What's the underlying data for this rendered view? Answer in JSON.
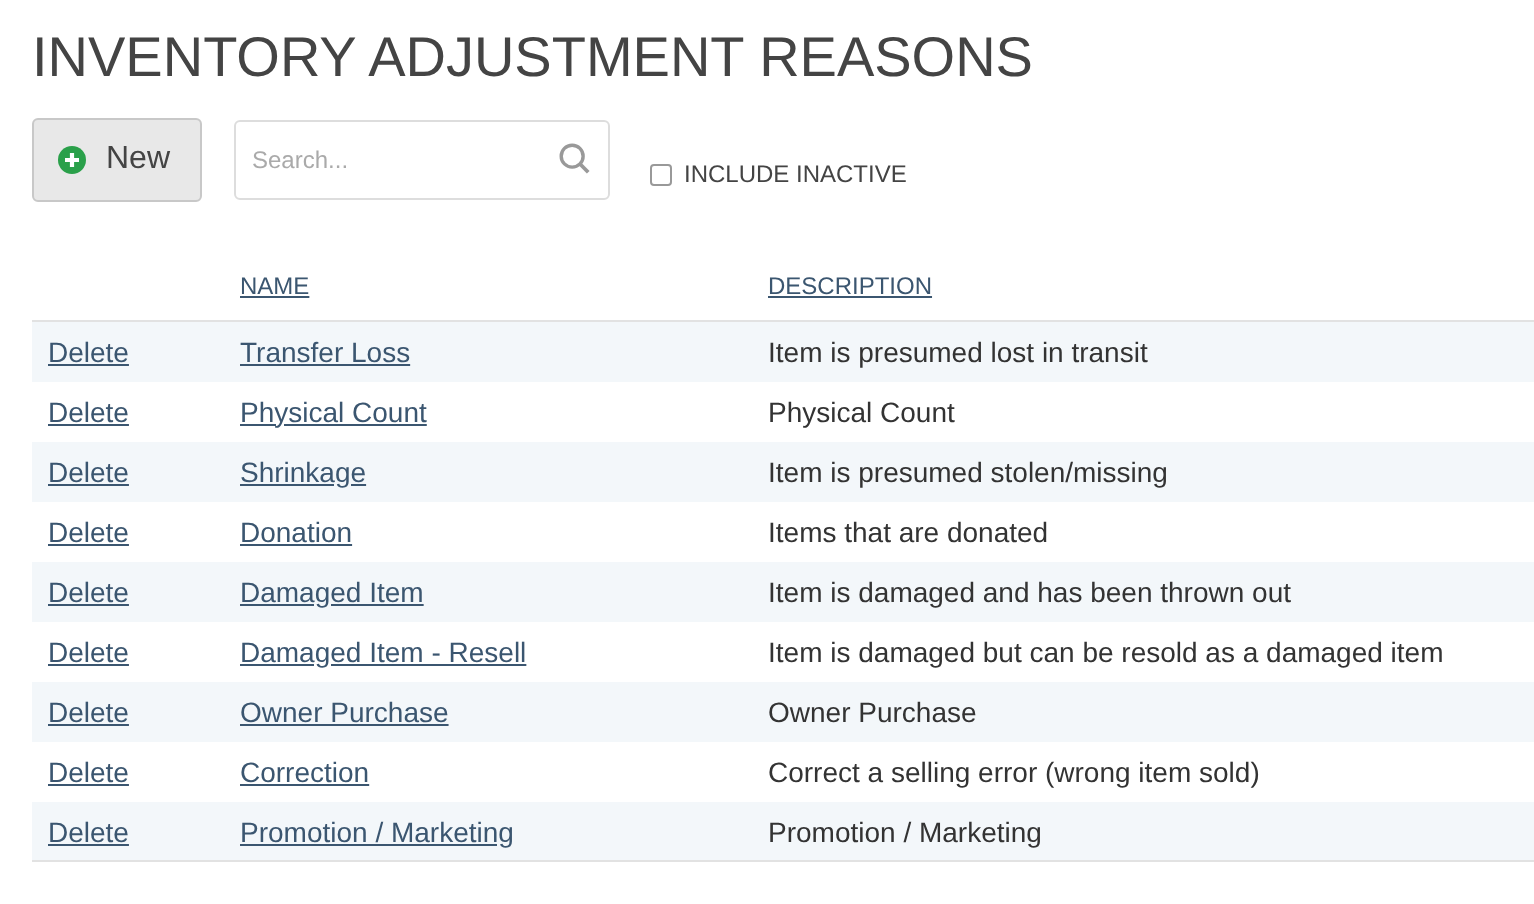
{
  "title": "INVENTORY ADJUSTMENT REASONS",
  "toolbar": {
    "new_button": "New",
    "search": {
      "placeholder": "Search..."
    },
    "include_inactive": {
      "label": "INCLUDE INACTIVE",
      "checked": false
    }
  },
  "table": {
    "columns": [
      "NAME",
      "DESCRIPTION"
    ],
    "rows": [
      {
        "action": "Delete",
        "name": "Transfer Loss",
        "description": "Item is presumed lost in transit"
      },
      {
        "action": "Delete",
        "name": "Physical Count",
        "description": "Physical Count"
      },
      {
        "action": "Delete",
        "name": "Shrinkage",
        "description": "Item is presumed stolen/missing"
      },
      {
        "action": "Delete",
        "name": "Donation",
        "description": "Items that are donated"
      },
      {
        "action": "Delete",
        "name": "Damaged Item",
        "description": "Item is damaged and has been thrown out"
      },
      {
        "action": "Delete",
        "name": "Damaged Item - Resell",
        "description": "Item is damaged but can be resold as a damaged item"
      },
      {
        "action": "Delete",
        "name": "Owner Purchase",
        "description": "Owner Purchase"
      },
      {
        "action": "Delete",
        "name": "Correction",
        "description": "Correct a selling error (wrong item sold)"
      },
      {
        "action": "Delete",
        "name": "Promotion / Marketing",
        "description": "Promotion / Marketing"
      }
    ]
  }
}
